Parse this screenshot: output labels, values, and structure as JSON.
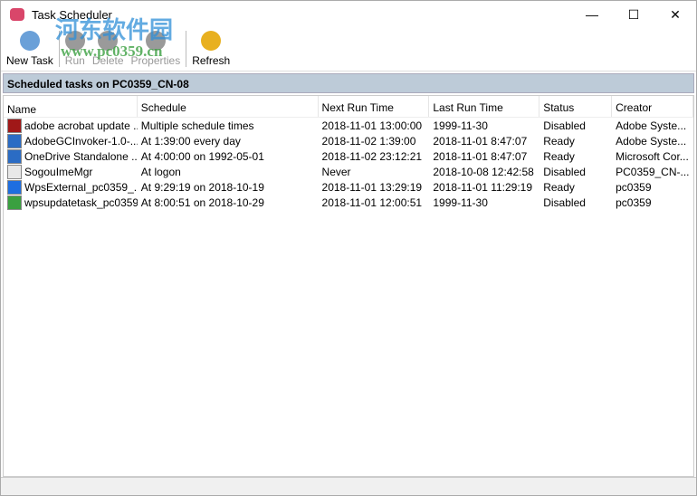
{
  "window": {
    "title": "Task Scheduler"
  },
  "watermark": {
    "text": "河东软件园",
    "url": "www.pc0359.cn"
  },
  "toolbar": [
    {
      "label": "New Task",
      "icon": "new-task-icon",
      "enabled": true
    },
    {
      "label": "Run",
      "icon": "run-icon",
      "enabled": false
    },
    {
      "label": "Delete",
      "icon": "delete-icon",
      "enabled": false
    },
    {
      "label": "Properties",
      "icon": "properties-icon",
      "enabled": false
    },
    {
      "label": "Refresh",
      "icon": "refresh-icon",
      "enabled": true
    }
  ],
  "strip": "Scheduled tasks on PC0359_CN-08",
  "columns": [
    "Name",
    "Schedule",
    "Next Run Time",
    "Last Run Time",
    "Status",
    "Creator"
  ],
  "rows": [
    {
      "icon": "#a01818",
      "cells": [
        "adobe acrobat update ...",
        "Multiple schedule times",
        "2018-11-01 13:00:00",
        "1999-11-30",
        "Disabled",
        "Adobe Syste..."
      ]
    },
    {
      "icon": "#2b6cc4",
      "cells": [
        "AdobeGCInvoker-1.0-...",
        "At 1:39:00 every day",
        "2018-11-02 1:39:00",
        "2018-11-01 8:47:07",
        "Ready",
        "Adobe Syste..."
      ]
    },
    {
      "icon": "#2b6cc4",
      "cells": [
        "OneDrive Standalone ...",
        "At 4:00:00 on 1992-05-01",
        "2018-11-02 23:12:21",
        "2018-11-01 8:47:07",
        "Ready",
        "Microsoft Cor..."
      ]
    },
    {
      "icon": "#e8e8e8",
      "cells": [
        "SogouImeMgr",
        "At logon",
        "Never",
        "2018-10-08 12:42:58",
        "Disabled",
        "PC0359_CN-..."
      ]
    },
    {
      "icon": "#1e6ee0",
      "cells": [
        "WpsExternal_pc0359_...",
        "At 9:29:19 on 2018-10-19",
        "2018-11-01 13:29:19",
        "2018-11-01 11:29:19",
        "Ready",
        "pc0359"
      ]
    },
    {
      "icon": "#3aa040",
      "cells": [
        "wpsupdatetask_pc0359",
        "At 8:00:51 on 2018-10-29",
        "2018-11-01 12:00:51",
        "1999-11-30",
        "Disabled",
        "pc0359"
      ]
    }
  ]
}
